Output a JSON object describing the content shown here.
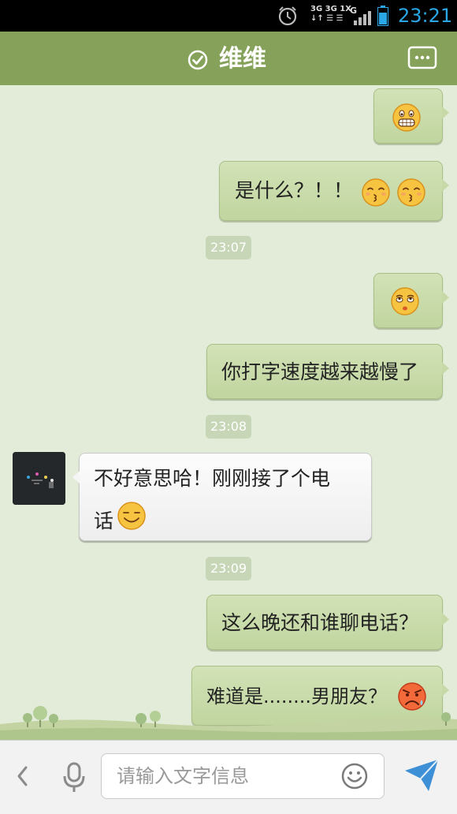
{
  "status_bar": {
    "time": "23:21",
    "network_top": "3G 3G 1X",
    "network_bottom": "↓↑ ☰ ☰",
    "network_type": "G"
  },
  "header": {
    "title": "维维",
    "title_color": "#ffffff",
    "bar_color": "#86a25a"
  },
  "messages": [
    {
      "side": "out",
      "text": "",
      "emojis": [
        "grin-emoji"
      ]
    },
    {
      "side": "out",
      "text": "是什么？！！",
      "emojis": [
        "kiss-emoji",
        "kiss-emoji"
      ]
    },
    {
      "timestamp": "23:07"
    },
    {
      "side": "out",
      "text": "",
      "emojis": [
        "eyeroll-emoji"
      ]
    },
    {
      "side": "out",
      "text": "你打字速度越来越慢了",
      "emojis": []
    },
    {
      "timestamp": "23:08"
    },
    {
      "side": "in",
      "text_line1": "不好意思哈！刚刚接了个电",
      "text_line2": "话",
      "emojis": [
        "smile-emoji"
      ]
    },
    {
      "timestamp": "23:09"
    },
    {
      "side": "out",
      "text": "这么晚还和谁聊电话？",
      "emojis": []
    },
    {
      "side": "out",
      "text": "难道是........男朋友？",
      "emojis": [
        "angry-emoji"
      ]
    }
  ],
  "input": {
    "placeholder": "请输入文字信息"
  },
  "colors": {
    "chat_background": "#e3ecd9",
    "outgoing_bubble": "#c6d9a6",
    "incoming_bubble": "#f5f5f5",
    "time_color": "#2aa7e6",
    "send_color": "#3d8fd6"
  }
}
